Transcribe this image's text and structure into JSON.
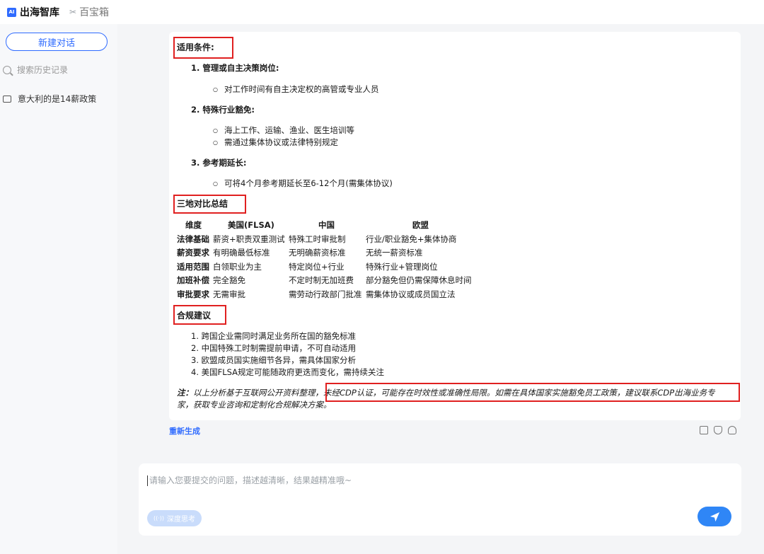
{
  "header": {
    "logo_text": "AI",
    "app_title": "出海智库",
    "tool_icon": "toolbox-icon",
    "tool_label": "百宝箱"
  },
  "sidebar": {
    "new_chat": "新建对话",
    "search_placeholder": "搜索历史记录",
    "history": [
      {
        "label": "意大利的是14薪政策"
      }
    ]
  },
  "answer": {
    "applicable_heading": "适用条件:",
    "cond1_title": "1. 管理或自主决策岗位:",
    "cond1_b1": "对工作时间有自主决定权的高管或专业人员",
    "cond2_title": "2. 特殊行业豁免:",
    "cond2_b1": "海上工作、运输、渔业、医生培训等",
    "cond2_b2": "需通过集体协议或法律特别规定",
    "cond3_title": "3. 参考期延长:",
    "cond3_b1": "可将4个月参考期延长至6-12个月(需集体协议)",
    "summary_heading": "三地对比总结",
    "table": {
      "headers": [
        "维度",
        "美国(FLSA)",
        "中国",
        "欧盟"
      ],
      "rows": [
        [
          "法律基础",
          "薪资+职责双重测试",
          "特殊工时审批制",
          "行业/职业豁免+集体协商"
        ],
        [
          "薪资要求",
          "有明确最低标准",
          "无明确薪资标准",
          "无统一薪资标准"
        ],
        [
          "适用范围",
          "白领职业为主",
          "特定岗位+行业",
          "特殊行业+管理岗位"
        ],
        [
          "加班补偿",
          "完全豁免",
          "不定时制无加班费",
          "部分豁免但仍需保障休息时间"
        ],
        [
          "审批要求",
          "无需审批",
          "需劳动行政部门批准",
          "需集体协议或成员国立法"
        ]
      ]
    },
    "compliance_heading": "合规建议",
    "advice": [
      "1. 跨国企业需同时满足业务所在国的豁免标准",
      "2. 中国特殊工时制需提前申请，不可自动适用",
      "3. 欧盟成员国实施细节各异，需具体国家分析",
      "4. 美国FLSA规定可能随政府更迭而变化，需持续关注"
    ],
    "note_prefix": "注：",
    "note_part1": "以上分析基于互联网公开资料整理，",
    "note_part2": "未经CDP认证，可能存在时效性或准确性局限。如需在具体国家实施豁免员工政策，建议联系CDP出海业务专",
    "note_part3": "家，获取专业咨询和定制化合规解决方案。"
  },
  "actions": {
    "regenerate": "重新生成",
    "copy_icon": "copy-icon",
    "like_icon": "thumbs-up-icon",
    "dislike_icon": "thumbs-down-icon"
  },
  "input": {
    "placeholder": "请输入您要提交的问题，描述越清晰，结果越精准哦~",
    "deep_think": "深度思考",
    "send_icon": "send-icon"
  },
  "colors": {
    "accent": "#2f6bff",
    "highlight_border": "#e02020",
    "send_button": "#2f86f6"
  }
}
